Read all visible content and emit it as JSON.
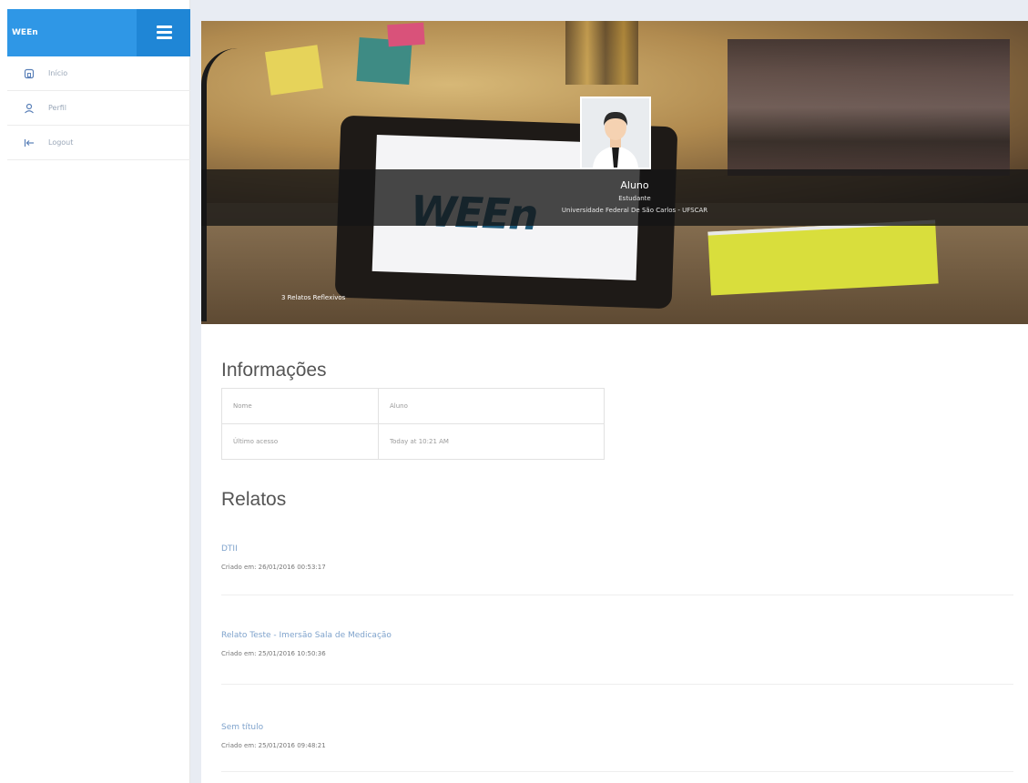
{
  "sidebar": {
    "brand": "WEEn",
    "menu_icon": "hamburger-menu-icon",
    "items": [
      {
        "label": "Início",
        "icon": "home-icon"
      },
      {
        "label": "Perfil",
        "icon": "user-icon"
      },
      {
        "label": "Logout",
        "icon": "logout-icon"
      }
    ]
  },
  "profile": {
    "name": "Aluno",
    "role": "Estudante",
    "university": "Universidade Federal De São Carlos - UFSCAR",
    "report_count": "3 Relatos Reflexivos",
    "avatar_icon": "avatar-icon",
    "cover_logo": "WEEn"
  },
  "info": {
    "title": "Informações",
    "rows": [
      {
        "key": "Nome",
        "value": "Aluno"
      },
      {
        "key": "Último acesso",
        "value": "Today at 10:21 AM"
      }
    ]
  },
  "relatos": {
    "title": "Relatos",
    "items": [
      {
        "title": "DTII",
        "date": "Criado em: 26/01/2016 00:53:17"
      },
      {
        "title": "Relato Teste - Imersão Sala de Medicação",
        "date": "Criado em: 25/01/2016 10:50:36"
      },
      {
        "title": "Sem título",
        "date": "Criado em: 25/01/2016 09:48:21"
      }
    ]
  },
  "colors": {
    "brand_blue": "#2f97e6",
    "toggle_blue": "#1f86d6",
    "link_blue": "#7fa3cc",
    "nav_icon": "#5a80b8"
  }
}
